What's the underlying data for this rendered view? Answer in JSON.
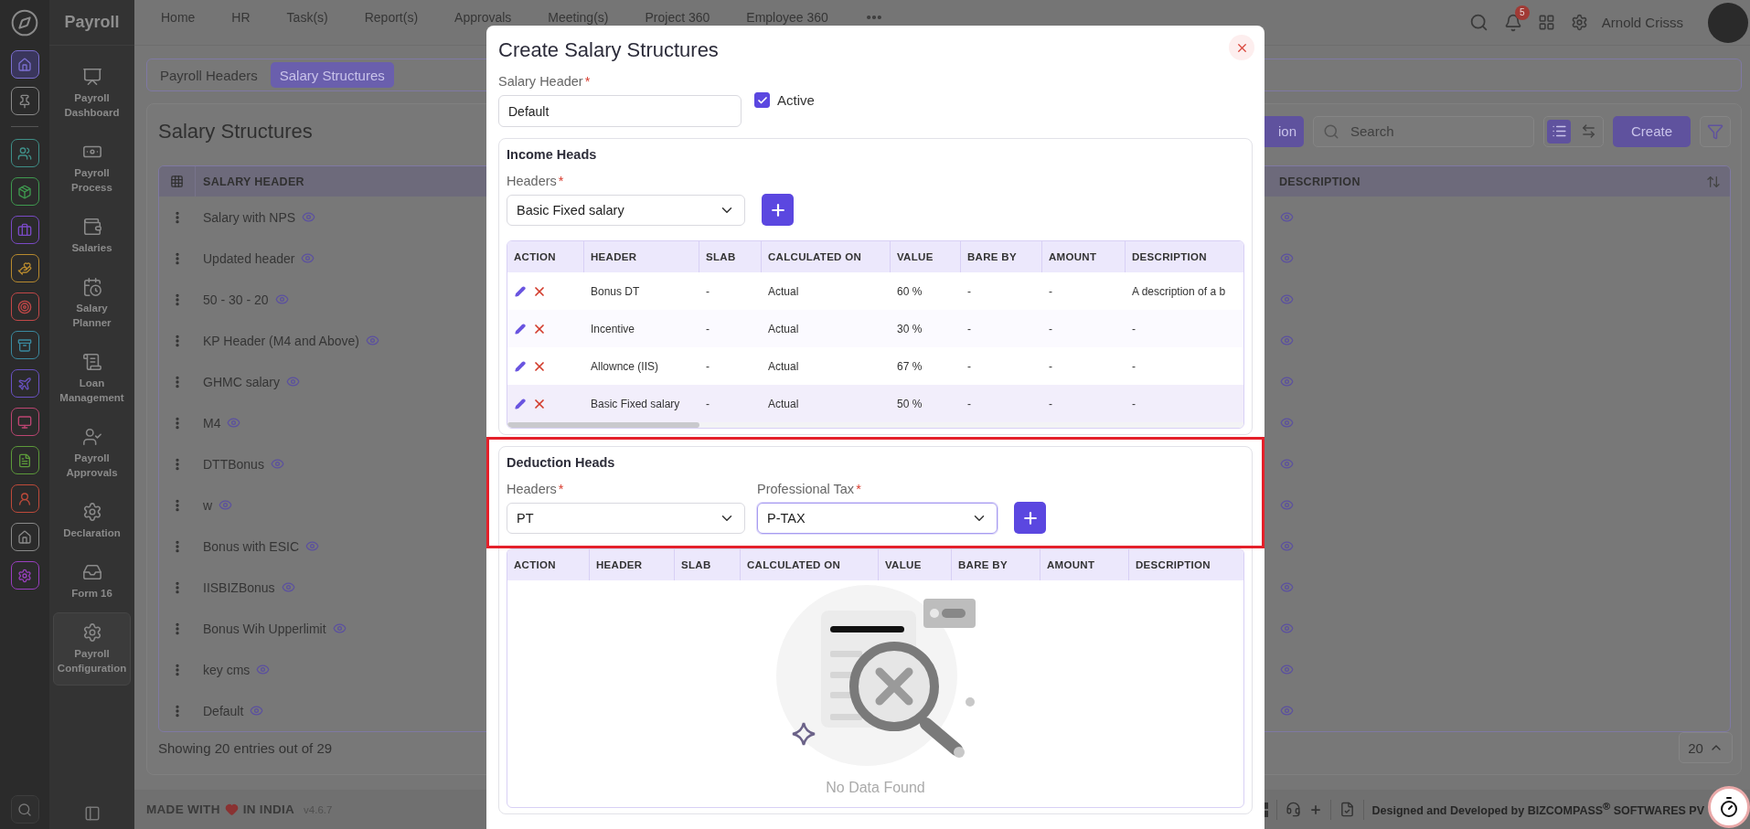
{
  "rail": {
    "top": [
      {
        "kind": "home",
        "color": "#7b6fd0",
        "selected": true
      },
      {
        "kind": "pin",
        "color": "#8a8a8a",
        "selected": false
      }
    ],
    "apps": [
      {
        "kind": "people",
        "color": "#3f8f88",
        "selected": false
      },
      {
        "kind": "box",
        "color": "#3f9a4f",
        "selected": false
      },
      {
        "kind": "briefcase",
        "color": "#7a4ac6",
        "selected": false
      },
      {
        "kind": "hand-heart",
        "color": "#b88a2e",
        "selected": false
      },
      {
        "kind": "target",
        "color": "#c24848",
        "selected": false
      },
      {
        "kind": "archive",
        "color": "#3a8aa0",
        "selected": false
      },
      {
        "kind": "plane",
        "color": "#6a52c4",
        "selected": false
      },
      {
        "kind": "monitor",
        "color": "#bd4572",
        "selected": false
      },
      {
        "kind": "document",
        "color": "#5c9a3a",
        "selected": false
      },
      {
        "kind": "person",
        "color": "#bf4a3a",
        "selected": false
      },
      {
        "kind": "house",
        "color": "#8a8a8a",
        "selected": false
      },
      {
        "kind": "gear",
        "color": "#9a3fc0",
        "selected": false
      }
    ]
  },
  "sidebar": {
    "title": "Payroll",
    "items": [
      {
        "kind": "dashboard",
        "label": "Payroll Dashboard",
        "selected": false
      },
      {
        "kind": "money",
        "label": "Payroll Process",
        "selected": false
      },
      {
        "kind": "wallet",
        "label": "Salaries",
        "selected": false
      },
      {
        "kind": "calendar",
        "label": "Salary Planner",
        "selected": false
      },
      {
        "kind": "scroll",
        "label": "Loan Management",
        "selected": false
      },
      {
        "kind": "approval",
        "label": "Payroll Approvals",
        "selected": false
      },
      {
        "kind": "gear",
        "label": "Declaration",
        "selected": false
      },
      {
        "kind": "inbox",
        "label": "Form 16",
        "selected": false
      },
      {
        "kind": "gear",
        "label": "Payroll Configuration",
        "selected": true
      }
    ]
  },
  "nav": [
    "Home",
    "HR",
    "Task(s)",
    "Report(s)",
    "Approvals",
    "Meeting(s)",
    "Project 360",
    "Employee 360"
  ],
  "header": {
    "notifications": "5",
    "user": "Arnold Crisss"
  },
  "page_tabs": [
    {
      "label": "Payroll Headers",
      "selected": false
    },
    {
      "label": "Salary Structures",
      "selected": true
    }
  ],
  "page": {
    "title": "Salary Structures",
    "toolbar": {
      "cut_button": "ion",
      "search_placeholder": "Search",
      "create": "Create",
      "view_toggle": [
        {
          "kind": "list",
          "selected": true
        },
        {
          "kind": "swap",
          "selected": false
        }
      ]
    },
    "columns": [
      "SALARY HEADER",
      "DESCRIPTION"
    ],
    "rows": [
      "Salary with NPS",
      "Updated header",
      "50 - 30 - 20",
      "KP Header (M4 and Above)",
      "GHMC salary",
      "M4",
      "DTTBonus",
      "w",
      "Bonus with ESIC",
      "IISBIZBonus",
      "Bonus Wih Upperlimit",
      "key cms",
      "Default"
    ],
    "entries": "Showing 20 entries out of 29",
    "page_size": "20"
  },
  "footer": {
    "made_with": "MADE WITH",
    "in_india": "IN INDIA",
    "version": "v4.6.7",
    "credit": "Designed and Developed by BIZCOMPASS$^{®}$ SOFTWARES PV"
  },
  "modal": {
    "title": "Create Salary Structures",
    "salary_header": {
      "label": "Salary Header",
      "required_mark": "*",
      "value": "Default"
    },
    "active": {
      "label": "Active",
      "checked": true
    },
    "income_heads": {
      "title": "Income Heads",
      "fields": [
        {
          "label": "Headers",
          "required_mark": "*",
          "value": "Basic Fixed salary",
          "focused": false
        }
      ],
      "columns": [
        "ACTION",
        "HEADER",
        "SLAB",
        "CALCULATED ON",
        "VALUE",
        "BARE BY",
        "AMOUNT",
        "DESCRIPTION"
      ],
      "rows": [
        {
          "selected": false,
          "cells": [
            "",
            "Bonus DT",
            "-",
            "Actual",
            "60 %",
            "-",
            "-",
            "A description of a b"
          ]
        },
        {
          "selected": false,
          "cells": [
            "",
            "Incentive",
            "-",
            "Actual",
            "30 %",
            "-",
            "-",
            "-"
          ]
        },
        {
          "selected": false,
          "cells": [
            "",
            "Allownce (IIS)",
            "-",
            "Actual",
            "67 %",
            "-",
            "-",
            "-"
          ]
        },
        {
          "selected": true,
          "cells": [
            "",
            "Basic Fixed salary",
            "-",
            "Actual",
            "50 %",
            "-",
            "-",
            "-"
          ]
        }
      ]
    },
    "deduction_heads": {
      "title": "Deduction Heads",
      "highlighted": true,
      "fields": [
        {
          "label": "Headers",
          "required_mark": "*",
          "value": "PT",
          "focused": false
        },
        {
          "label": "Professional Tax",
          "required_mark": "*",
          "value": "P-TAX",
          "focused": true
        }
      ],
      "columns": [
        "ACTION",
        "HEADER",
        "SLAB",
        "CALCULATED ON",
        "VALUE",
        "BARE BY",
        "AMOUNT",
        "DESCRIPTION"
      ],
      "empty_message": "No Data Found"
    }
  }
}
